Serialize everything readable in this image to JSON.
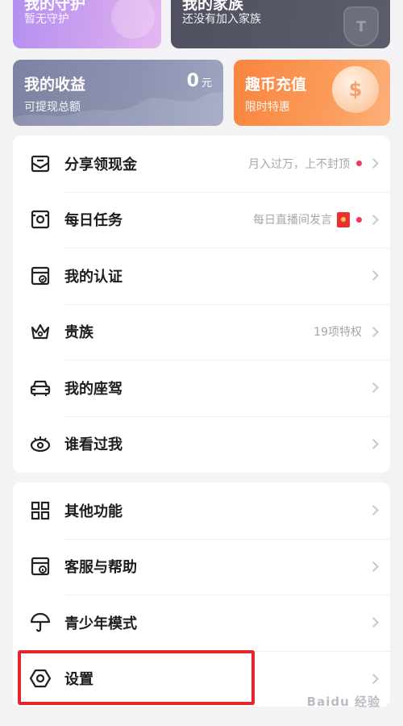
{
  "cards": {
    "guard": {
      "title": "我的守护",
      "subtitle": "暂无守护"
    },
    "family": {
      "title": "我的家族",
      "subtitle": "还没有加入家族",
      "badge_letter": "T"
    },
    "income": {
      "title": "我的收益",
      "subtitle": "可提现总额",
      "amount": "0",
      "unit": "元"
    },
    "coins": {
      "title": "趣币充值",
      "subtitle": "限时特惠",
      "coin_symbol": "$"
    }
  },
  "section1": [
    {
      "key": "share",
      "label": "分享领现金",
      "hint": "月入过万，上不封顶",
      "dot": true,
      "icon": "envelope-share-icon"
    },
    {
      "key": "daily",
      "label": "每日任务",
      "hint": "每日直播间发言",
      "red_packet": true,
      "dot": true,
      "icon": "daily-task-icon"
    },
    {
      "key": "verify",
      "label": "我的认证",
      "hint": "",
      "icon": "verify-badge-icon"
    },
    {
      "key": "noble",
      "label": "贵族",
      "hint": "19项特权",
      "icon": "crown-icon"
    },
    {
      "key": "car",
      "label": "我的座驾",
      "hint": "",
      "icon": "car-icon"
    },
    {
      "key": "visitors",
      "label": "谁看过我",
      "hint": "",
      "icon": "eye-icon"
    }
  ],
  "section2": [
    {
      "key": "more",
      "label": "其他功能",
      "icon": "grid-icon"
    },
    {
      "key": "help",
      "label": "客服与帮助",
      "icon": "help-info-icon"
    },
    {
      "key": "youth",
      "label": "青少年模式",
      "icon": "umbrella-icon"
    },
    {
      "key": "settings",
      "label": "设置",
      "icon": "settings-hexagon-icon"
    }
  ],
  "watermark": "Baidu 经验",
  "colors": {
    "accent_red": "#e3262d",
    "dot_red": "#f5365c",
    "guard_card": "#c39cf0",
    "family_card": "#54556a",
    "income_card": "#878cab",
    "coins_card": "#fa9150"
  }
}
